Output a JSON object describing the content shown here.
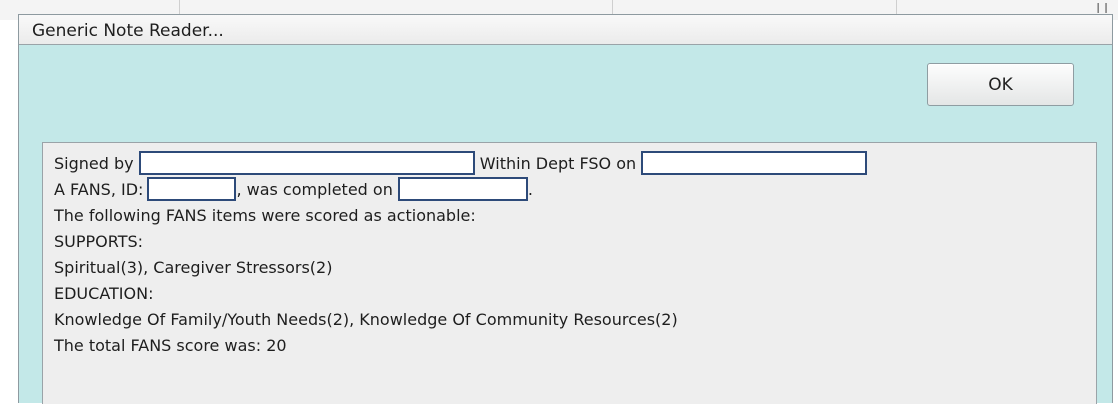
{
  "background": {
    "trailing_glyph": "I I"
  },
  "dialog": {
    "title": "Generic Note Reader...",
    "ok_label": "OK",
    "background_color": "#c3e8e8"
  },
  "note": {
    "signed_by_label": "Signed by",
    "within_dept_label": "Within Dept FSO on",
    "fans_id_label": "A FANS, ID:",
    "completed_on_label": ", was completed on",
    "period": ".",
    "scored_actionable": "The following FANS items were scored as actionable:",
    "supports_heading": "SUPPORTS:",
    "supports_items": "Spiritual(3), Caregiver Stressors(2)",
    "education_heading": "EDUCATION:",
    "education_items": "Knowledge Of Family/Youth Needs(2), Knowledge Of Community Resources(2)",
    "total_score": "The total FANS score was: 20"
  }
}
